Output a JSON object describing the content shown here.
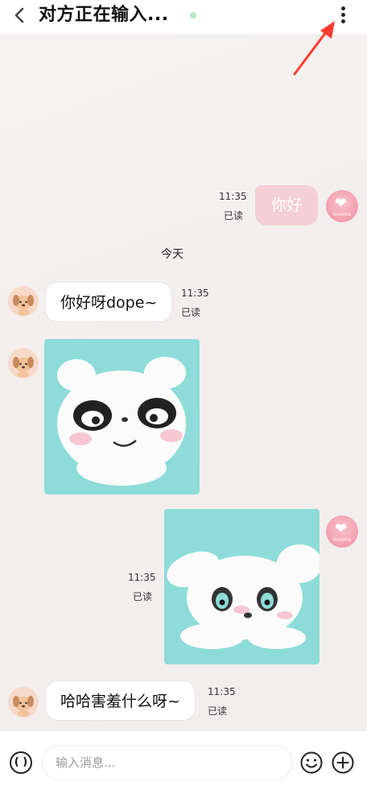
{
  "header": {
    "title": "对方正在输入...",
    "accent_color": "#ff3b30"
  },
  "messages": [
    {
      "direction": "out",
      "text": "你好",
      "time": "11:35",
      "status": "已读",
      "avatar": "lovemo"
    },
    {
      "separator": "今天"
    },
    {
      "direction": "in",
      "text": "你好呀dope~",
      "time": "11:35",
      "status": "已读",
      "avatar": "dog"
    },
    {
      "direction": "in",
      "type": "sticker",
      "sticker": "angry-puppy",
      "avatar": "dog"
    },
    {
      "direction": "out",
      "type": "sticker",
      "sticker": "shy-puppy",
      "time": "11:35",
      "status": "已读",
      "avatar": "lovemo"
    },
    {
      "direction": "in",
      "text": "哈哈害羞什么呀~",
      "time": "11:35",
      "status": "已读",
      "avatar": "dog"
    }
  ],
  "avatars": {
    "self_label": "lovemo"
  },
  "composer": {
    "voice_label": "( )",
    "placeholder": "输入消息..."
  },
  "colors": {
    "sent_bubble": "#f4cfd3",
    "sticker_bg": "#8edcd9",
    "online_dot": "#b6e3c4"
  }
}
